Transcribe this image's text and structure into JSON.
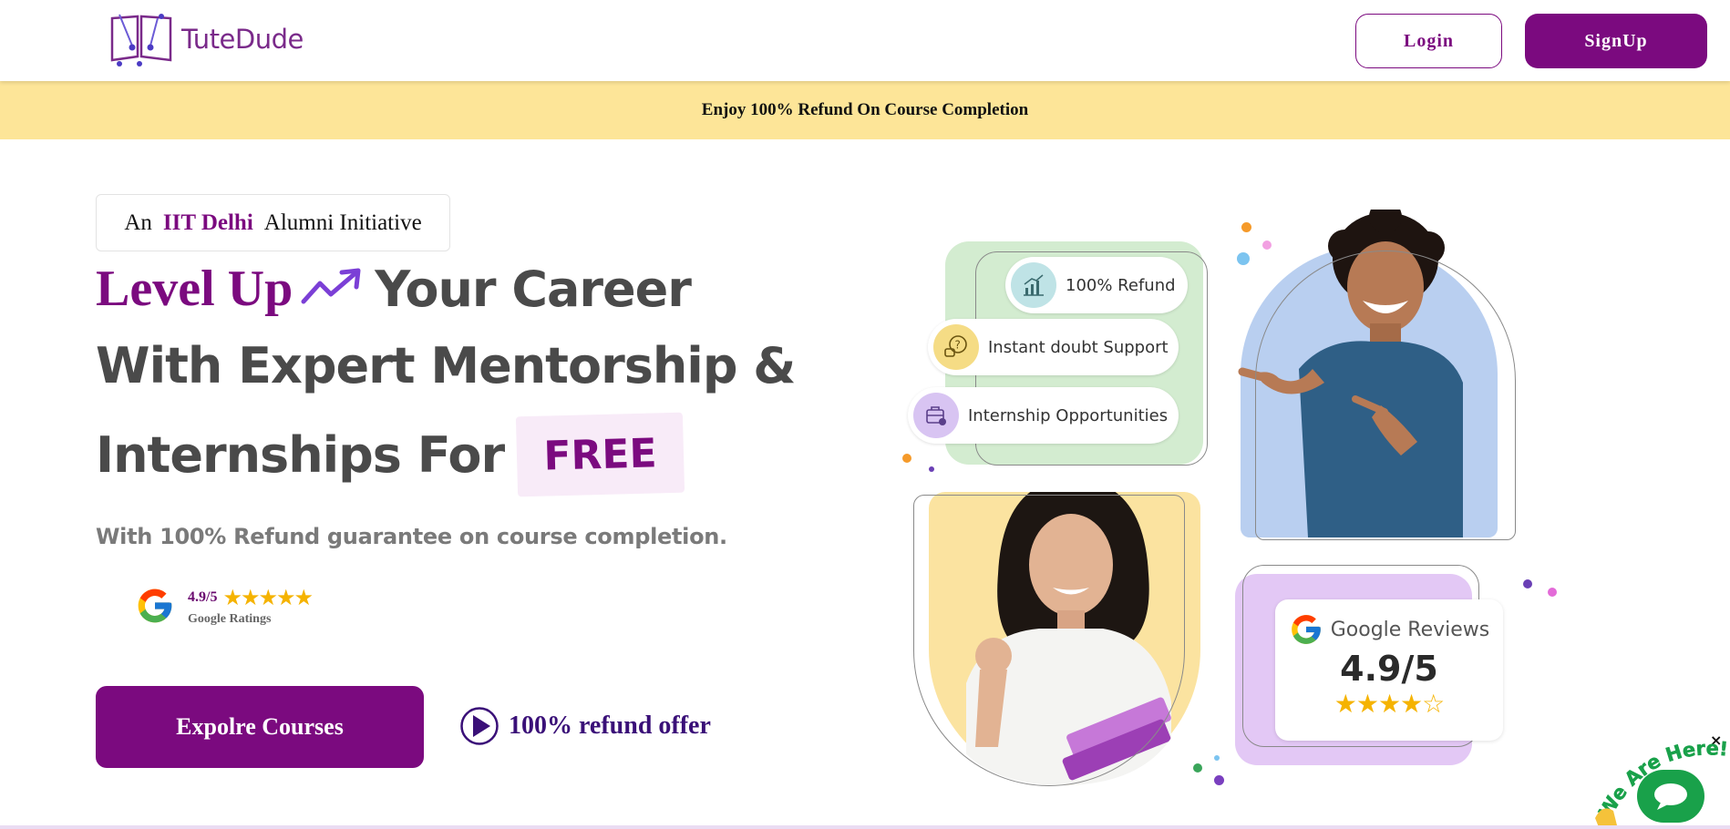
{
  "header": {
    "logo_text": "TuteDude",
    "login_label": "Login",
    "signup_label": "SignUp"
  },
  "banner": {
    "text": "Enjoy 100% Refund On Course Completion"
  },
  "hero": {
    "tagline_prefix": "An",
    "tagline_highlight": "IIT Delhi",
    "tagline_suffix": "Alumni Initiative",
    "headline_highlight": "Level Up",
    "headline_line1_rest": "Your Career",
    "headline_line2": "With Expert Mentorship &",
    "headline_line3": "Internships For",
    "headline_free": "FREE",
    "subtitle": "With 100% Refund guarantee on course completion.",
    "rating_score": "4.9/5",
    "rating_stars": "★★★★★",
    "rating_label": "Google Ratings",
    "explore_label": "Expolre Courses",
    "refund_offer_label": "100% refund offer"
  },
  "illustration": {
    "features": [
      {
        "label": "100% Refund",
        "icon": "chart-growth-icon"
      },
      {
        "label": "Instant doubt Support",
        "icon": "question-bubble-icon"
      },
      {
        "label": "Internship Opportunities",
        "icon": "briefcase-icon"
      }
    ],
    "reviews_title": "Google Reviews",
    "reviews_score": "4.9/5",
    "reviews_stars": "★★★★☆"
  },
  "chat": {
    "arc_text": "We Are Here!",
    "close_label": "×"
  },
  "colors": {
    "brand_purple": "#7b0a7f",
    "banner_yellow": "#fde598",
    "star_gold": "#f5b300",
    "chat_green": "#19a14a"
  }
}
